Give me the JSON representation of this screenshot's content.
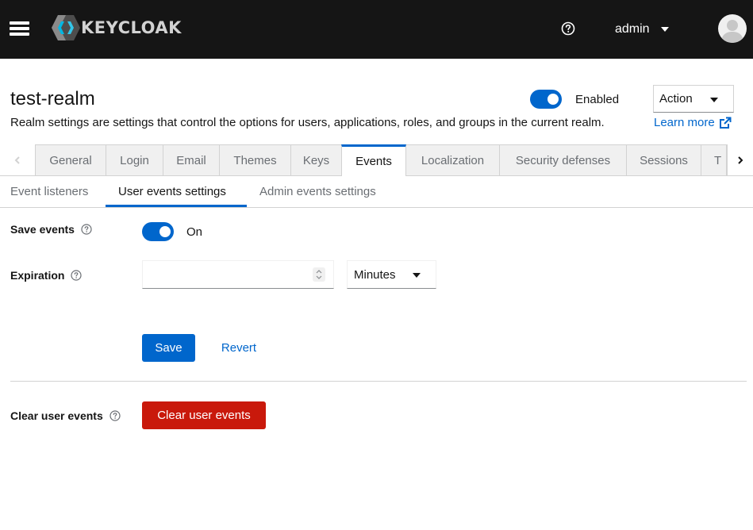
{
  "masthead": {
    "brand": "KEYCLOAK",
    "user_name": "admin",
    "background": "#151515"
  },
  "header": {
    "title": "test-realm",
    "description": "Realm settings are settings that control the options for users, applications, roles, and groups in the current realm.",
    "enabled_label": "Enabled",
    "enabled": true,
    "action_label": "Action",
    "learn_more_label": "Learn more"
  },
  "tabs": [
    {
      "label": "General",
      "active": false
    },
    {
      "label": "Login",
      "active": false
    },
    {
      "label": "Email",
      "active": false
    },
    {
      "label": "Themes",
      "active": false
    },
    {
      "label": "Keys",
      "active": false
    },
    {
      "label": "Events",
      "active": true
    },
    {
      "label": "Localization",
      "active": false
    },
    {
      "label": "Security defenses",
      "active": false
    },
    {
      "label": "Sessions",
      "active": false
    },
    {
      "label": "T",
      "active": false
    }
  ],
  "subtabs": [
    {
      "label": "Event listeners",
      "active": false
    },
    {
      "label": "User events settings",
      "active": true
    },
    {
      "label": "Admin events settings",
      "active": false
    }
  ],
  "form": {
    "save_events_label": "Save events",
    "save_events_value": "On",
    "save_events_on": true,
    "expiration_label": "Expiration",
    "expiration_value": "",
    "expiration_unit": "Minutes",
    "save_label": "Save",
    "revert_label": "Revert",
    "clear_label": "Clear user events",
    "clear_button_label": "Clear user events"
  },
  "colors": {
    "primary": "#0066cc",
    "danger": "#c9190b",
    "border": "#d2d2d2"
  }
}
